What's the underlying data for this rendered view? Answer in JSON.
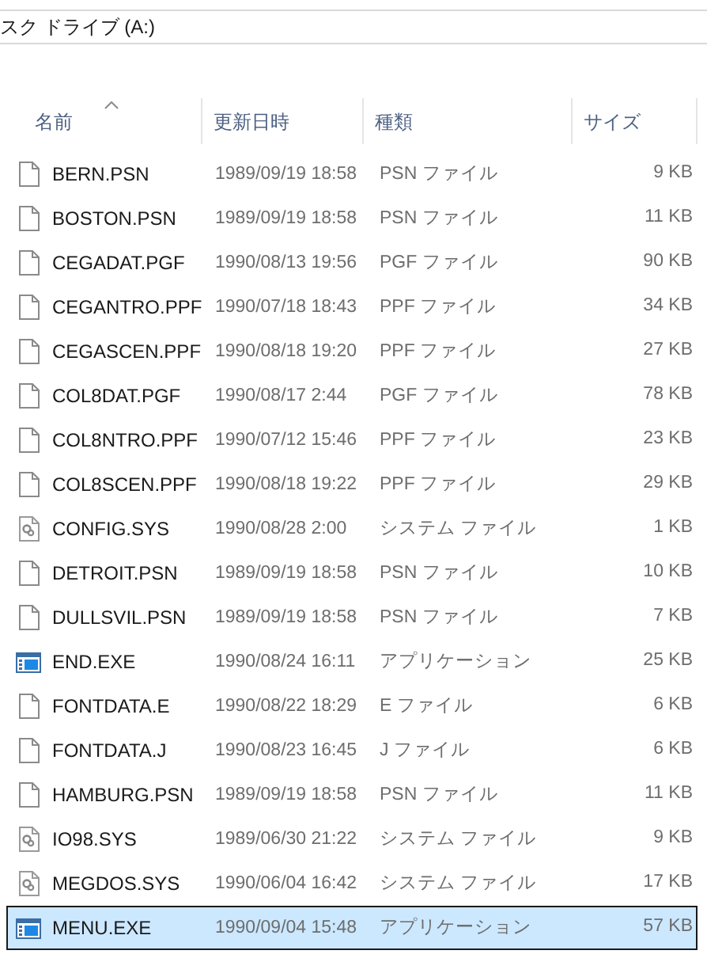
{
  "address_bar": {
    "path": "スク ドライブ (A:)"
  },
  "table": {
    "columns": [
      {
        "label": "名前",
        "sorted": true
      },
      {
        "label": "更新日時",
        "sorted": false
      },
      {
        "label": "種類",
        "sorted": false
      },
      {
        "label": "サイズ",
        "sorted": false
      }
    ],
    "rows": [
      {
        "kind": "file",
        "name": "BERN.PSN",
        "date": "1989/09/19 18:58",
        "type": "PSN ファイル",
        "size": "9 KB",
        "selected": false
      },
      {
        "kind": "file",
        "name": "BOSTON.PSN",
        "date": "1989/09/19 18:58",
        "type": "PSN ファイル",
        "size": "11 KB",
        "selected": false
      },
      {
        "kind": "file",
        "name": "CEGADAT.PGF",
        "date": "1990/08/13 19:56",
        "type": "PGF ファイル",
        "size": "90 KB",
        "selected": false
      },
      {
        "kind": "file",
        "name": "CEGANTRO.PPF",
        "date": "1990/07/18 18:43",
        "type": "PPF ファイル",
        "size": "34 KB",
        "selected": false
      },
      {
        "kind": "file",
        "name": "CEGASCEN.PPF",
        "date": "1990/08/18 19:20",
        "type": "PPF ファイル",
        "size": "27 KB",
        "selected": false
      },
      {
        "kind": "file",
        "name": "COL8DAT.PGF",
        "date": "1990/08/17 2:44",
        "type": "PGF ファイル",
        "size": "78 KB",
        "selected": false
      },
      {
        "kind": "file",
        "name": "COL8NTRO.PPF",
        "date": "1990/07/12 15:46",
        "type": "PPF ファイル",
        "size": "23 KB",
        "selected": false
      },
      {
        "kind": "file",
        "name": "COL8SCEN.PPF",
        "date": "1990/08/18 19:22",
        "type": "PPF ファイル",
        "size": "29 KB",
        "selected": false
      },
      {
        "kind": "system",
        "name": "CONFIG.SYS",
        "date": "1990/08/28 2:00",
        "type": "システム ファイル",
        "size": "1 KB",
        "selected": false
      },
      {
        "kind": "file",
        "name": "DETROIT.PSN",
        "date": "1989/09/19 18:58",
        "type": "PSN ファイル",
        "size": "10 KB",
        "selected": false
      },
      {
        "kind": "file",
        "name": "DULLSVIL.PSN",
        "date": "1989/09/19 18:58",
        "type": "PSN ファイル",
        "size": "7 KB",
        "selected": false
      },
      {
        "kind": "app",
        "name": "END.EXE",
        "date": "1990/08/24 16:11",
        "type": "アプリケーション",
        "size": "25 KB",
        "selected": false
      },
      {
        "kind": "file",
        "name": "FONTDATA.E",
        "date": "1990/08/22 18:29",
        "type": "E ファイル",
        "size": "6 KB",
        "selected": false
      },
      {
        "kind": "file",
        "name": "FONTDATA.J",
        "date": "1990/08/23 16:45",
        "type": "J ファイル",
        "size": "6 KB",
        "selected": false
      },
      {
        "kind": "file",
        "name": "HAMBURG.PSN",
        "date": "1989/09/19 18:58",
        "type": "PSN ファイル",
        "size": "11 KB",
        "selected": false
      },
      {
        "kind": "system",
        "name": "IO98.SYS",
        "date": "1989/06/30 21:22",
        "type": "システム ファイル",
        "size": "9 KB",
        "selected": false
      },
      {
        "kind": "system",
        "name": "MEGDOS.SYS",
        "date": "1990/06/04 16:42",
        "type": "システム ファイル",
        "size": "17 KB",
        "selected": false
      },
      {
        "kind": "app",
        "name": "MENU.EXE",
        "date": "1990/09/04 15:48",
        "type": "アプリケーション",
        "size": "57 KB",
        "selected": true
      }
    ]
  }
}
